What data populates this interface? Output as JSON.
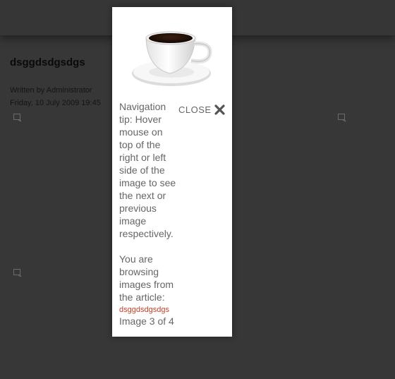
{
  "article": {
    "title": "dsggdsdgsdgs",
    "author_line": "Written by Administrator",
    "date_line": "Friday, 10 July 2009 19:45"
  },
  "page_icons": [
    "image-placeholder-icon",
    "image-placeholder-icon",
    "image-placeholder-icon"
  ],
  "lightbox": {
    "image_icon": "coffee-cup-image",
    "close_label": "CLOSE",
    "close_icon": "close-x-icon",
    "tip_text": "Navigation tip: Hover mouse on top of the right or left side of the image to see the next or previous image respectively.",
    "browsing_text": "You are browsing images from the article:",
    "article_link": "dsggdsdgsdgs",
    "counter": "Image 3 of 4"
  },
  "colors": {
    "background": "#373737",
    "panel": "#ffffff",
    "text": "#666666",
    "link": "#c1412b"
  }
}
